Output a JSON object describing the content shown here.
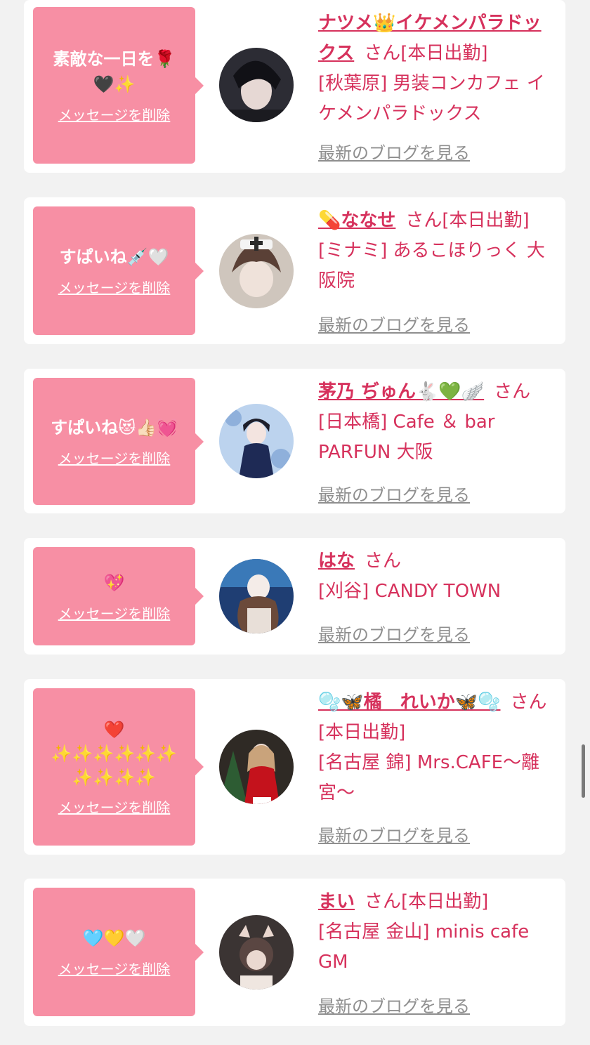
{
  "delete_label": "メッセージを削除",
  "blog_label": "最新のブログを見る",
  "honorific": "さん",
  "accent_color": "#f78fa4",
  "link_color": "#d6315c",
  "cards": [
    {
      "message": "素敵な一日を🌹\n🖤✨",
      "name": "ナツメ👑イケメンパラドックス",
      "status": "[本日出勤]",
      "shop": "[秋葉原] 男装コンカフェ イケメンパラドックス"
    },
    {
      "message": "すぱいね💉🤍",
      "name": "💊ななせ",
      "status": "[本日出勤]",
      "shop": "[ミナミ] あるこほりっく 大阪院"
    },
    {
      "message": "すぱいね😻👍🏻💓",
      "name": "茅乃 ぢゅん🐇💚🪽",
      "status": "",
      "shop": "[日本橋] Cafe ＆ bar PARFUN 大阪"
    },
    {
      "message": "💖",
      "name": "はな",
      "status": "",
      "shop": "[刈谷] CANDY TOWN"
    },
    {
      "message": "❤️\n✨✨✨✨✨✨\n✨✨✨✨",
      "name": "🫧🦋橘　れいか🦋🫧",
      "status": "[本日出勤]",
      "shop": "[名古屋 錦] Mrs.CAFE〜離宮〜"
    },
    {
      "message": "🩵💛🤍",
      "name": "まい",
      "status": "[本日出勤]",
      "shop": "[名古屋 金山] minis cafe GM"
    }
  ]
}
